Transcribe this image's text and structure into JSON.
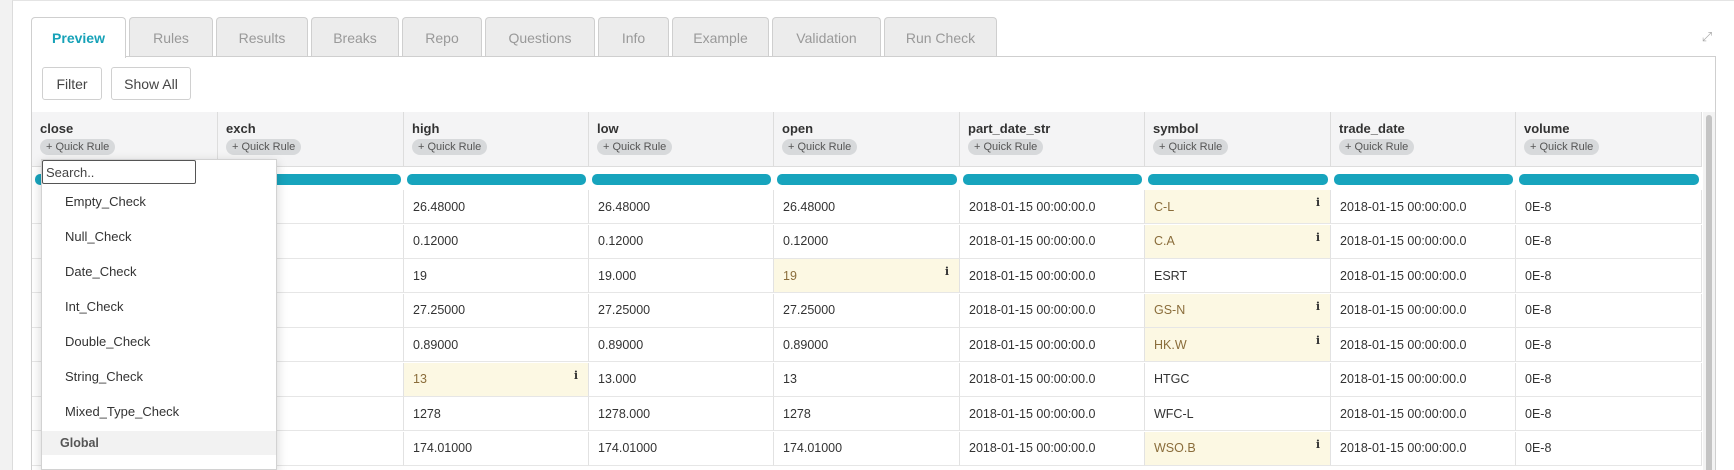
{
  "tabs": [
    {
      "label": "Preview",
      "active": true
    },
    {
      "label": "Rules",
      "active": false
    },
    {
      "label": "Results",
      "active": false
    },
    {
      "label": "Breaks",
      "active": false
    },
    {
      "label": "Repo",
      "active": false
    },
    {
      "label": "Questions",
      "active": false
    },
    {
      "label": "Info",
      "active": false
    },
    {
      "label": "Example",
      "active": false
    },
    {
      "label": "Validation",
      "active": false
    },
    {
      "label": "Run Check",
      "active": false
    }
  ],
  "toolbar": {
    "filter_label": "Filter",
    "show_all_label": "Show All"
  },
  "quick_rule_label": "+ Quick Rule",
  "columns": [
    "close",
    "exch",
    "high",
    "low",
    "open",
    "part_date_str",
    "symbol",
    "trade_date",
    "volume"
  ],
  "rows": [
    [
      "",
      "",
      "26.48000",
      "26.48000",
      "26.48000",
      "2018-01-15 00:00:00.0",
      "C-L",
      "2018-01-15 00:00:00.0",
      "0E-8"
    ],
    [
      "",
      "",
      "0.12000",
      "0.12000",
      "0.12000",
      "2018-01-15 00:00:00.0",
      "C.A",
      "2018-01-15 00:00:00.0",
      "0E-8"
    ],
    [
      "",
      "",
      "19",
      "19.000",
      "19",
      "2018-01-15 00:00:00.0",
      "ESRT",
      "2018-01-15 00:00:00.0",
      "0E-8"
    ],
    [
      "",
      "",
      "27.25000",
      "27.25000",
      "27.25000",
      "2018-01-15 00:00:00.0",
      "GS-N",
      "2018-01-15 00:00:00.0",
      "0E-8"
    ],
    [
      "",
      "",
      "0.89000",
      "0.89000",
      "0.89000",
      "2018-01-15 00:00:00.0",
      "HK.W",
      "2018-01-15 00:00:00.0",
      "0E-8"
    ],
    [
      "",
      "",
      "13",
      "13.000",
      "13",
      "2018-01-15 00:00:00.0",
      "HTGC",
      "2018-01-15 00:00:00.0",
      "0E-8"
    ],
    [
      "",
      "",
      "1278",
      "1278.000",
      "1278",
      "2018-01-15 00:00:00.0",
      "WFC-L",
      "2018-01-15 00:00:00.0",
      "0E-8"
    ],
    [
      "",
      "",
      "174.01000",
      "174.01000",
      "174.01000",
      "2018-01-15 00:00:00.0",
      "WSO.B",
      "2018-01-15 00:00:00.0",
      "0E-8"
    ]
  ],
  "highlights": [
    {
      "row": 0,
      "col": 6
    },
    {
      "row": 1,
      "col": 6
    },
    {
      "row": 2,
      "col": 4
    },
    {
      "row": 3,
      "col": 6
    },
    {
      "row": 4,
      "col": 6
    },
    {
      "row": 5,
      "col": 2
    },
    {
      "row": 7,
      "col": 6
    }
  ],
  "info_icon_glyph": "i",
  "colors": {
    "accent": "#17a2b8",
    "bar": "#17a4bd",
    "highlight_bg": "#fcf8e3",
    "highlight_text": "#8a6d3b"
  },
  "dropdown": {
    "search_placeholder": "Search..",
    "options": [
      "Empty_Check",
      "Null_Check",
      "Date_Check",
      "Int_Check",
      "Double_Check",
      "String_Check",
      "Mixed_Type_Check"
    ],
    "group_label": "Global"
  },
  "icons": {
    "expand": "expand-icon",
    "info": "info-icon"
  }
}
